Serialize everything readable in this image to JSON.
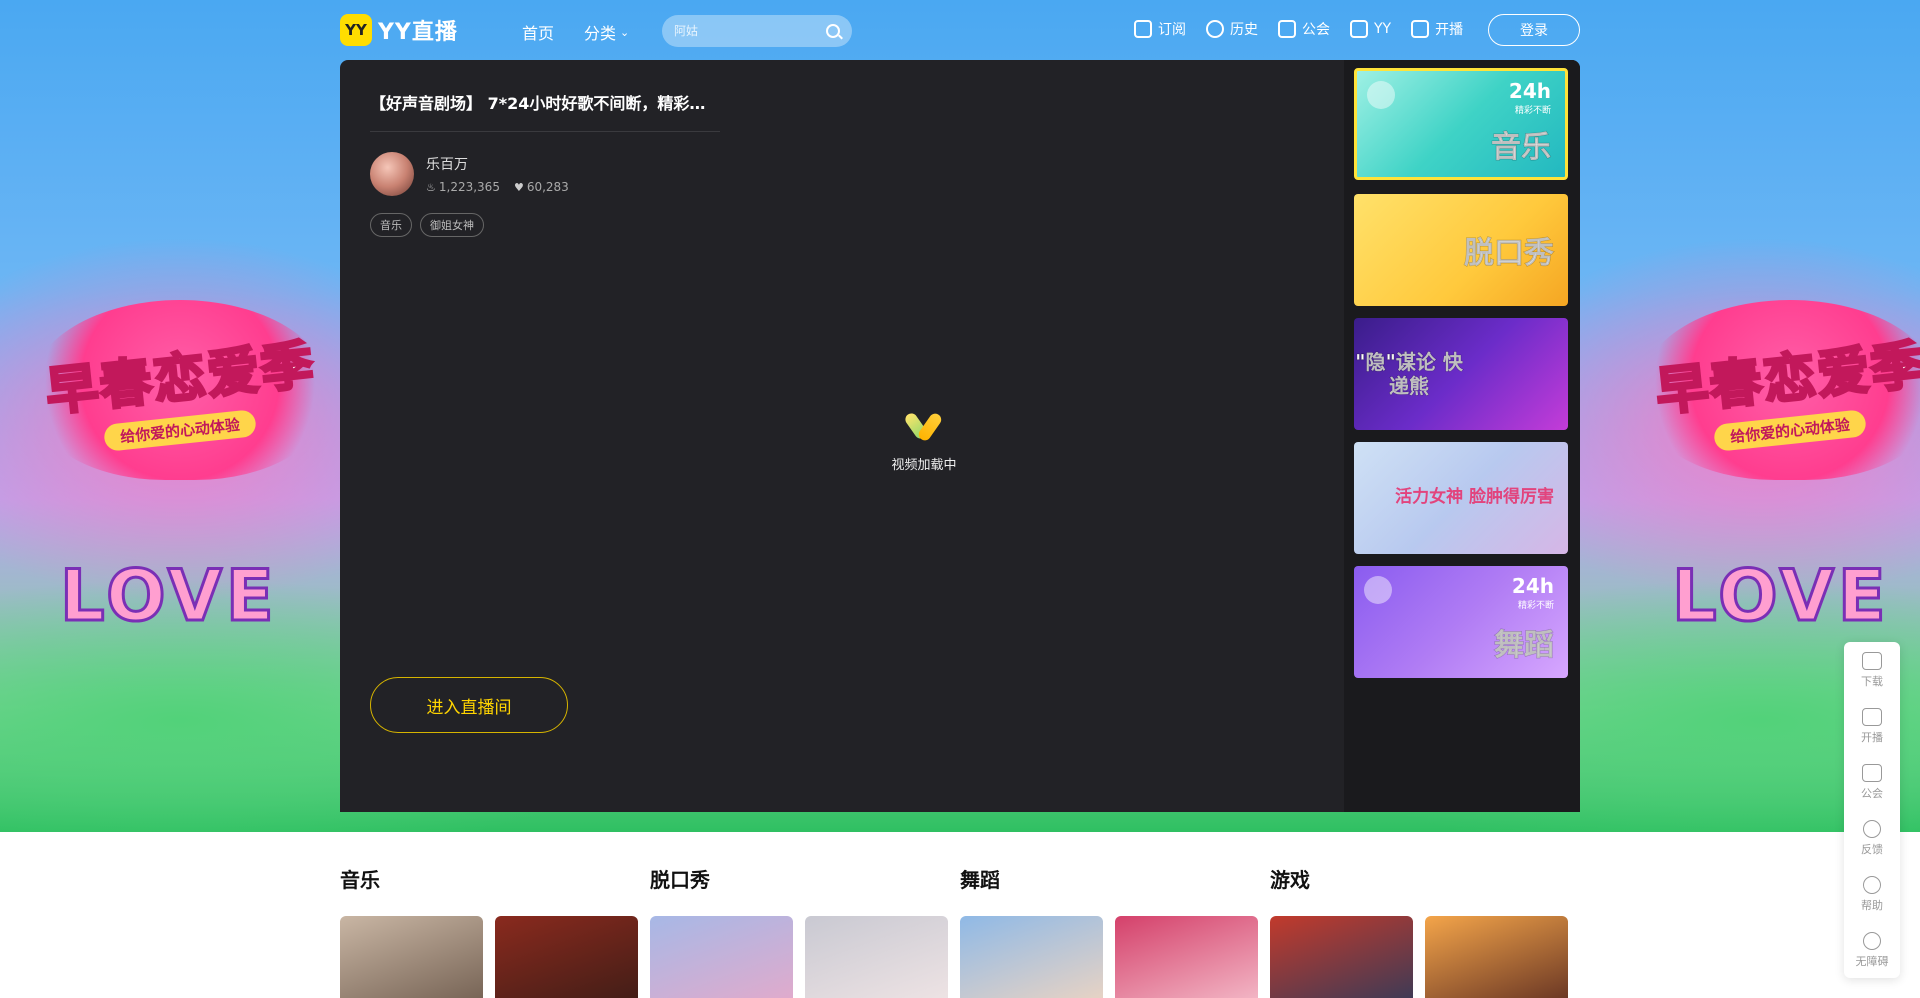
{
  "header": {
    "logo_badge": "YY",
    "logo_text": "YY直播",
    "nav_home": "首页",
    "nav_category": "分类",
    "search_placeholder": "阿姑",
    "menu": [
      {
        "label": "订阅",
        "icon": "bookmark-icon"
      },
      {
        "label": "历史",
        "icon": "clock-icon"
      },
      {
        "label": "公会",
        "icon": "shield-icon"
      },
      {
        "label": "YY",
        "icon": "yy-icon"
      },
      {
        "label": "开播",
        "icon": "camera-icon"
      }
    ],
    "login_label": "登录"
  },
  "hero": {
    "deco_title": "早春恋爱季",
    "deco_subtitle": "给你爱的心动体验",
    "love_text": "LOVE"
  },
  "player": {
    "room_title": "【好声音剧场】 7*24小时好歌不间断，精彩不...",
    "host_name": "乐百万",
    "heat": "1,223,365",
    "likes": "60,283",
    "tags": [
      "音乐",
      "御姐女神"
    ],
    "loading_text": "视频加载中",
    "enter_button": "进入直播间"
  },
  "side_thumbs": [
    {
      "label": "音乐",
      "badge": "24h",
      "badge_sub": "精彩不断"
    },
    {
      "label": "脱口秀"
    },
    {
      "label": "\"隐\"谋论 快递熊"
    },
    {
      "label": "活力女神 脸肿得厉害"
    },
    {
      "label": "舞蹈",
      "badge": "24h",
      "badge_sub": "精彩不断"
    }
  ],
  "categories": [
    {
      "title": "音乐"
    },
    {
      "title": "脱口秀"
    },
    {
      "title": "舞蹈"
    },
    {
      "title": "游戏"
    }
  ],
  "float_bar": [
    {
      "label": "下载",
      "icon": "download-icon"
    },
    {
      "label": "开播",
      "icon": "camera-icon"
    },
    {
      "label": "公会",
      "icon": "shield-icon"
    },
    {
      "label": "反馈",
      "icon": "feedback-icon"
    },
    {
      "label": "帮助",
      "icon": "headset-icon"
    },
    {
      "label": "无障碍",
      "icon": "accessibility-icon"
    }
  ],
  "colors": {
    "accent": "#ffdd00",
    "enter_button": "#ffd400",
    "player_bg": "#222226"
  }
}
